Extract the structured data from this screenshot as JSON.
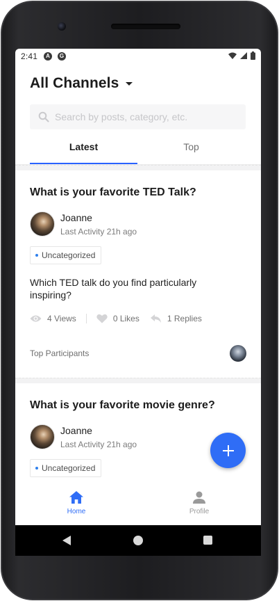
{
  "status_bar": {
    "time": "2:41",
    "icons": [
      "a-icon",
      "shield-icon",
      "wifi-icon",
      "signal-icon",
      "battery-icon"
    ]
  },
  "header": {
    "title": "All Channels"
  },
  "search": {
    "placeholder": "Search by posts, category, etc."
  },
  "tabs": [
    {
      "label": "Latest",
      "active": true
    },
    {
      "label": "Top",
      "active": false
    }
  ],
  "posts": [
    {
      "question": "What is your favorite TED Talk?",
      "author": "Joanne",
      "activity": "Last Activity 21h ago",
      "category": "Uncategorized",
      "body": "Which TED talk do you find particularly inspiring?",
      "views": "4 Views",
      "likes": "0 Likes",
      "replies": "1 Replies",
      "participants_label": "Top Participants"
    },
    {
      "question": "What is your favorite movie genre?",
      "author": "Joanne",
      "activity": "Last Activity 21h ago",
      "category": "Uncategorized"
    }
  ],
  "fab": {
    "icon": "plus-icon"
  },
  "bottom_nav": [
    {
      "label": "Home",
      "icon": "home-icon",
      "active": true
    },
    {
      "label": "Profile",
      "icon": "person-icon",
      "active": false
    }
  ],
  "colors": {
    "accent": "#2f6df6",
    "tab_indicator": "#2962ff",
    "badge_dot": "#2f80ed"
  }
}
